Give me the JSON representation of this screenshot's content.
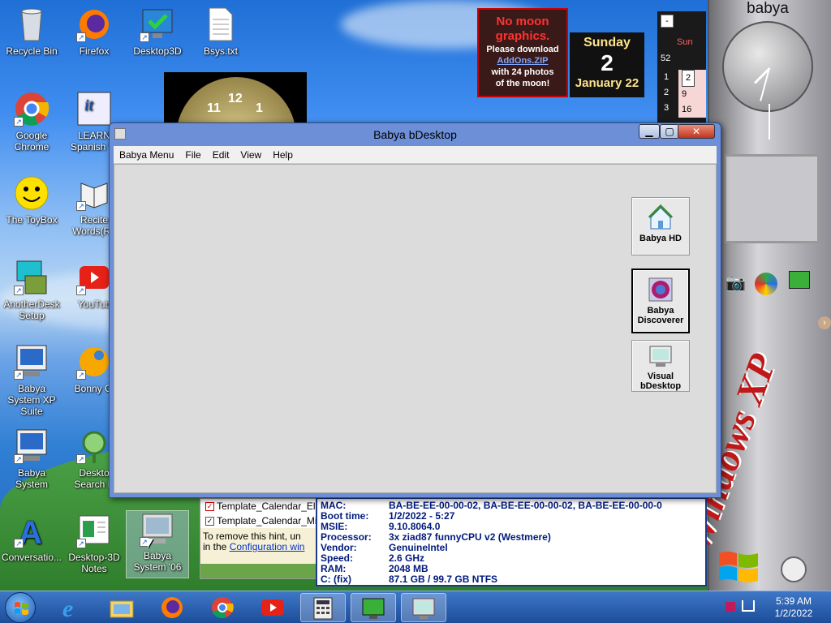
{
  "desktop": {
    "icons": [
      {
        "label": "Recycle Bin",
        "icon": "recycle-bin-icon"
      },
      {
        "label": "Firefox",
        "icon": "firefox-icon"
      },
      {
        "label": "Desktop3D",
        "icon": "monitor-check-icon"
      },
      {
        "label": "Bsys.txt",
        "icon": "text-file-icon"
      },
      {
        "label": "Google Chrome",
        "icon": "chrome-icon"
      },
      {
        "label": "LEARN Spanish W",
        "icon": "learn-spanish-icon"
      },
      {
        "label": "The ToyBox",
        "icon": "smiley-icon"
      },
      {
        "label": "Recite Words(Ru",
        "icon": "book-icon"
      },
      {
        "label": "AnotherDesk Setup",
        "icon": "setup-icon"
      },
      {
        "label": "YouTub",
        "icon": "youtube-icon"
      },
      {
        "label": "Babya System XP Suite",
        "icon": "babya-system-icon"
      },
      {
        "label": "Bonny Cl",
        "icon": "bonny-icon"
      },
      {
        "label": "Babya System",
        "icon": "babya-system-icon"
      },
      {
        "label": "Deskto Search E",
        "icon": "search-icon"
      },
      {
        "label": "Conversatio...",
        "icon": "conversation-icon"
      },
      {
        "label": "Desktop-3D Notes",
        "icon": "notes-icon"
      },
      {
        "label": "Babya System '06",
        "icon": "monitor-icon"
      }
    ]
  },
  "gadgets": {
    "clock_title": "babya",
    "moon": {
      "line1": "No moon",
      "line2": "graphics.",
      "line3": "Please download",
      "link": "AddOns.ZIP",
      "line4": "with 24 photos",
      "line5": "of the moon!"
    },
    "date": {
      "day": "Sunday",
      "num": "2",
      "month": "January 22"
    },
    "analog_numbers": [
      "11",
      "12",
      "1"
    ],
    "calendar": {
      "minus": "-",
      "week": "52",
      "rows": [
        "1",
        "2",
        "3"
      ],
      "dates": [
        "2",
        "9",
        "16"
      ],
      "sun": "Sun"
    }
  },
  "window": {
    "title": "Babya bDesktop",
    "minimize": "▁",
    "maximize": "▢",
    "close": "✕",
    "menus": [
      "Babya Menu",
      "File",
      "Edit",
      "View",
      "Help"
    ],
    "apps": [
      {
        "label": "Babya HD",
        "icon": "home-icon"
      },
      {
        "label": "Babya Discoverer",
        "icon": "discoverer-icon"
      },
      {
        "label": "Visual bDesktop",
        "icon": "monitor-icon"
      }
    ]
  },
  "hint": {
    "item1": "Template_Calendar_Elmue",
    "item2": "Template_Calendar_Mini",
    "text": "To remove this hint, un",
    "text2": "in the",
    "link": "Configuration win"
  },
  "sysinfo": {
    "rows": [
      {
        "k": "MAC:",
        "v": "BA-BE-EE-00-00-02, BA-BE-EE-00-00-02, BA-BE-EE-00-00-0"
      },
      {
        "k": "Boot time:",
        "v": "1/2/2022 - 5:27"
      },
      {
        "k": "MSIE:",
        "v": "9.10.8064.0"
      },
      {
        "k": "Processor:",
        "v": "3x ziad87 funnyCPU v2 (Westmere)"
      },
      {
        "k": "Vendor:",
        "v": "GenuineIntel"
      },
      {
        "k": "Speed:",
        "v": "2.6 GHz"
      },
      {
        "k": "RAM:",
        "v": "2048 MB"
      },
      {
        "k": "C: (fix)",
        "v": "87.1 GB / 99.7 GB  NTFS"
      }
    ]
  },
  "sidebar_logo": "Windows XP",
  "taskbar": {
    "time": "5:39 AM",
    "date": "1/2/2022"
  }
}
